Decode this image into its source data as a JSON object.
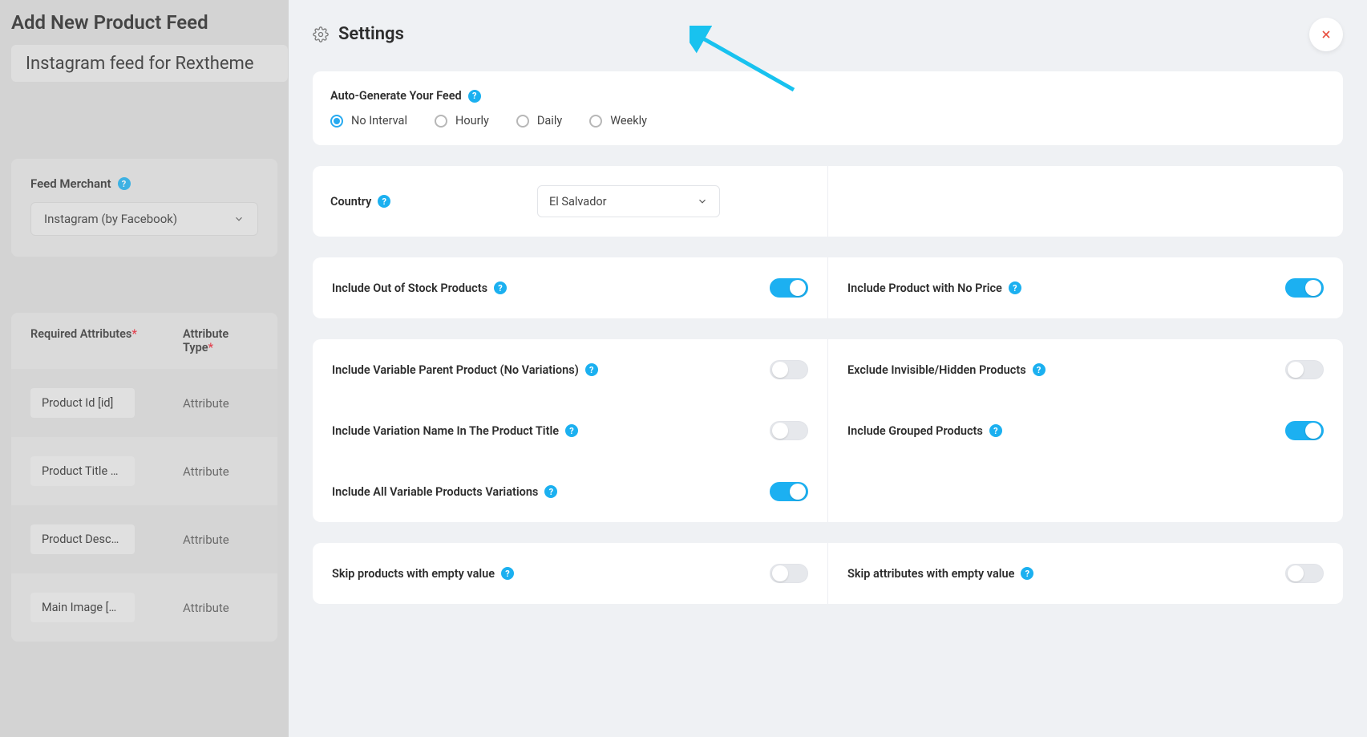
{
  "left": {
    "page_title": "Add New Product Feed",
    "feed_name": "Instagram feed for Rextheme",
    "merchant_label": "Feed Merchant",
    "merchant_value": "Instagram (by Facebook)",
    "attr_header_required": "Required Attributes",
    "attr_header_type": "Attribute Type",
    "rows": [
      {
        "chip": "Product Id [id]",
        "type": "Attribute"
      },
      {
        "chip": "Product Title …",
        "type": "Attribute"
      },
      {
        "chip": "Product Desc…",
        "type": "Attribute"
      },
      {
        "chip": "Main Image […",
        "type": "Attribute"
      }
    ]
  },
  "modal": {
    "title": "Settings",
    "autogen": {
      "label": "Auto-Generate Your Feed",
      "options": [
        "No Interval",
        "Hourly",
        "Daily",
        "Weekly"
      ],
      "selected": 0
    },
    "country": {
      "label": "Country",
      "value": "El Salvador"
    },
    "groups": [
      {
        "left": [
          {
            "label": "Include Out of Stock Products",
            "on": true
          }
        ],
        "right": [
          {
            "label": "Include Product with No Price",
            "on": true
          }
        ]
      },
      {
        "left": [
          {
            "label": "Include Variable Parent Product (No Variations)",
            "on": false
          },
          {
            "label": "Include Variation Name In The Product Title",
            "on": false
          },
          {
            "label": "Include All Variable Products Variations",
            "on": true
          }
        ],
        "right": [
          {
            "label": "Exclude Invisible/Hidden Products",
            "on": false
          },
          {
            "label": "Include Grouped Products",
            "on": true
          }
        ]
      },
      {
        "left": [
          {
            "label": "Skip products with empty value",
            "on": false
          }
        ],
        "right": [
          {
            "label": "Skip attributes with empty value",
            "on": false
          }
        ]
      }
    ]
  }
}
